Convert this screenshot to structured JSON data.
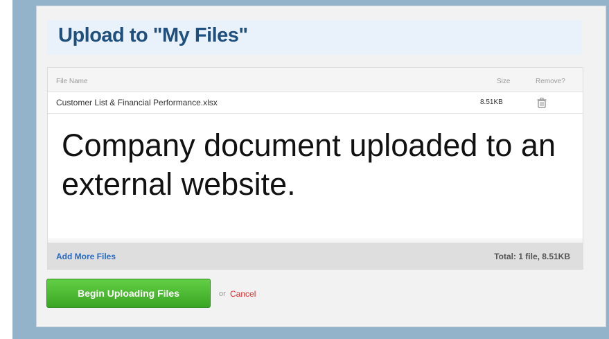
{
  "dialog": {
    "title": "Upload to \"My Files\""
  },
  "file_table": {
    "columns": {
      "name": "File Name",
      "size": "Size",
      "remove": "Remove?"
    },
    "rows": [
      {
        "name": "Customer List & Financial Performance.xlsx",
        "size": "8.51KB",
        "remove_icon": "trash-icon"
      }
    ]
  },
  "overlay": {
    "caption": "Company document uploaded to an external website."
  },
  "footer": {
    "add_more_label": "Add More Files",
    "total_label": "Total: 1 file, 8.51KB"
  },
  "actions": {
    "begin_label": "Begin Uploading Files",
    "or_text": "or",
    "cancel_label": "Cancel"
  },
  "colors": {
    "title": "#1f4f7d",
    "link": "#2a6ac1",
    "cancel": "#e0282a",
    "button_green": "#4cbb32",
    "frame_blue": "#93b3cb"
  }
}
